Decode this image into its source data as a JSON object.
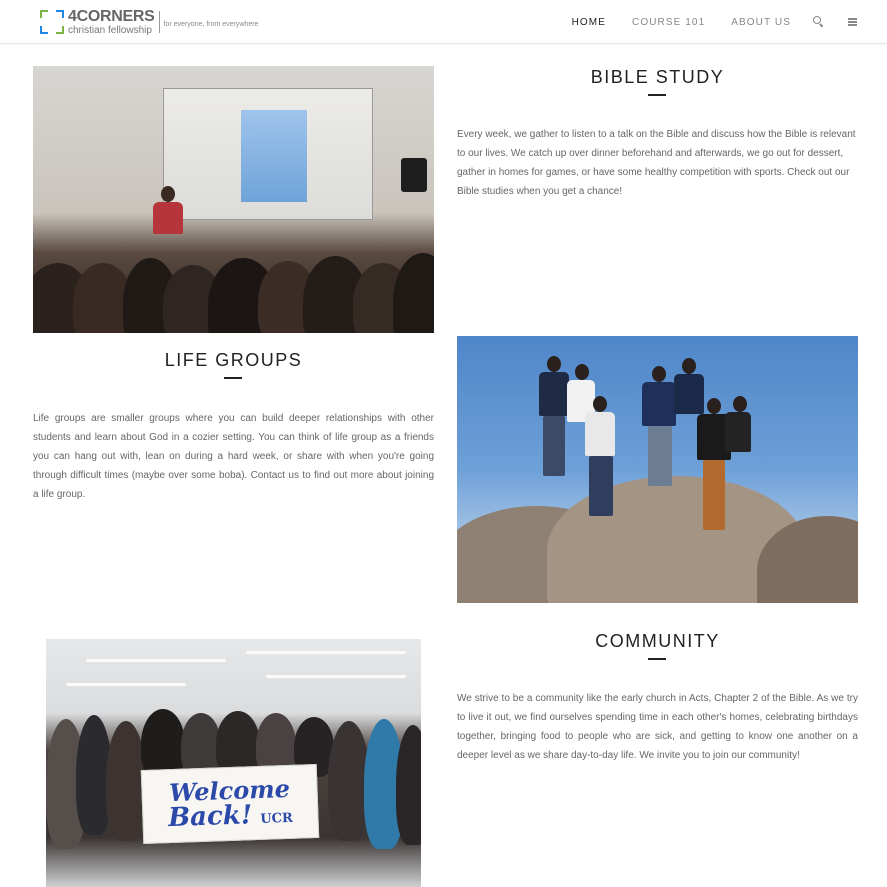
{
  "header": {
    "logo": {
      "name": "4CORNERS",
      "subtitle": "christian fellowship",
      "tagline": "for everyone, from everywhere"
    },
    "nav": [
      {
        "label": "HOME",
        "active": true
      },
      {
        "label": "COURSE 101",
        "active": false
      },
      {
        "label": "ABOUT US",
        "active": false
      }
    ],
    "icons": [
      "search-icon",
      "menu-icon"
    ]
  },
  "sections": {
    "bible_study": {
      "title": "BIBLE STUDY",
      "text": "Every week, we gather to listen to a talk on the Bible and discuss how the Bible is relevant to our lives. We catch up over dinner beforehand and afterwards, we go out for dessert, gather in homes for games, or have some healthy competition with sports. Check out our Bible studies when you get a chance!"
    },
    "life_groups": {
      "title": "LIFE GROUPS",
      "text": "Life groups are smaller groups where you can build deeper relationships with other students and learn about God in a cozier setting. You can think of life group as a friends you can hang out with, lean on during a hard week, or share with when you're going through difficult times (maybe over some boba). Contact us to find out more about joining a life group."
    },
    "community": {
      "title": "COMMUNITY",
      "text": "We strive to be a community like the early church in Acts, Chapter 2 of the Bible. As we try to live it out, we find ourselves spending time in each other's homes, celebrating birthdays together, bringing food to people who are sick, and getting to know one another on a deeper level as we share day-to-day life. We invite you to join our community!"
    }
  },
  "photos": {
    "banner_line1": "Welcome",
    "banner_line2": "Back!",
    "banner_tag": "UCR"
  },
  "colors": {
    "accent_text": "#222222",
    "body_text": "#666666",
    "logo_green": "#7cb342",
    "logo_blue": "#1e88e5"
  }
}
